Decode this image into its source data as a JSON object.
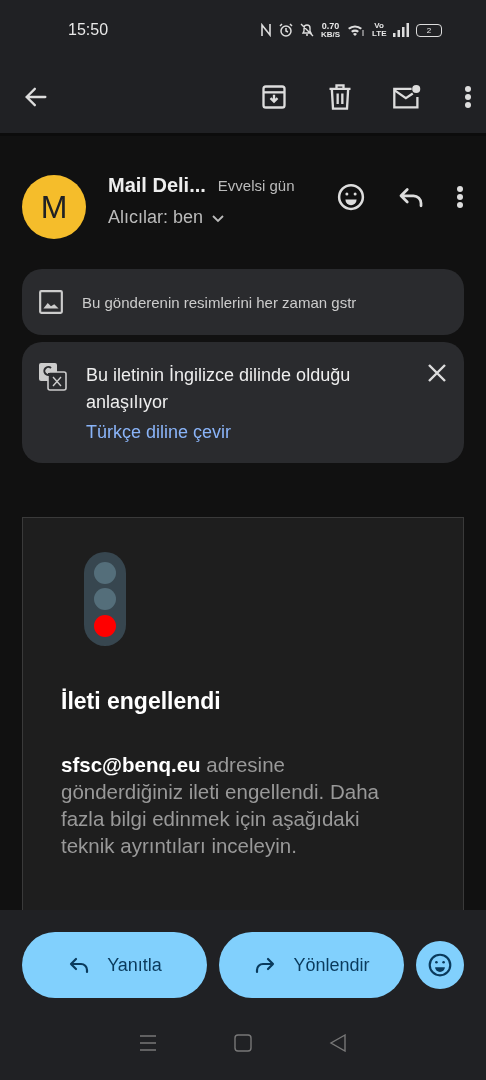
{
  "status_bar": {
    "time": "15:50",
    "speed_value": "0.70",
    "speed_unit": "KB/S",
    "network_label": "Vo LTE",
    "battery": "2"
  },
  "message": {
    "avatar_letter": "M",
    "sender": "Mail Deli...",
    "date": "Evvelsi gün",
    "recipients": "Alıcılar: ben"
  },
  "images_banner": {
    "text": "Bu gönderenin resimlerini her zaman gstr"
  },
  "translate_banner": {
    "text": "Bu iletinin İngilizce dilinde olduğu anlaşılıyor",
    "link": "Türkçe diline çevir"
  },
  "body": {
    "heading": "İleti engellendi",
    "paragraph": "**sfsc@benq.eu** adresine gönderdiğiniz ileti engellendi. Daha fazla bilgi edinmek için aşağıdaki teknik ayrıntıları inceleyin."
  },
  "actions": [
    {
      "kind": "reply",
      "label": "Yanıtla"
    },
    {
      "kind": "forward",
      "label": "Yönlendir"
    }
  ]
}
